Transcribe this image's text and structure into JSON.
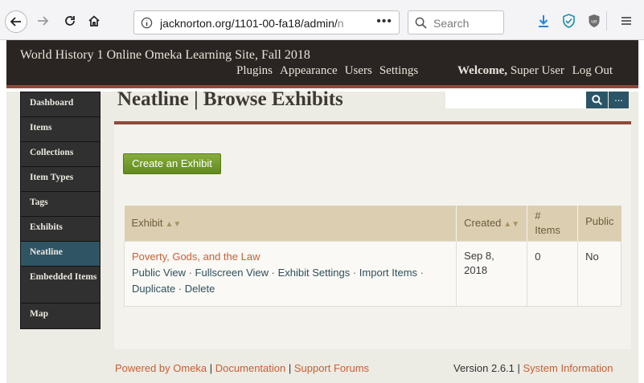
{
  "browser": {
    "url_main": "jacknorton.org/1101-00-fa18/admin/",
    "url_faded": "n",
    "url_more": "•••",
    "search_placeholder": "Search"
  },
  "site": {
    "title": "World History 1 Online Omeka Learning Site, Fall 2018",
    "nav": [
      "Plugins",
      "Appearance",
      "Users",
      "Settings"
    ],
    "welcome_label": "Welcome,",
    "user_name": "Super User",
    "logout": "Log Out"
  },
  "sidebar": {
    "items": [
      {
        "label": "Dashboard"
      },
      {
        "label": "Items"
      },
      {
        "label": "Collections"
      },
      {
        "label": "Item Types"
      },
      {
        "label": "Tags"
      },
      {
        "label": "Exhibits"
      },
      {
        "label": "Neatline",
        "active": true
      },
      {
        "label": "Embedded Items"
      },
      {
        "label": "Map"
      }
    ]
  },
  "page": {
    "title": "Neatline | Browse Exhibits",
    "search_more": "...",
    "create_button": "Create an Exhibit"
  },
  "table": {
    "headers": {
      "exhibit": "Exhibit",
      "created": "Created",
      "items_hash": "#",
      "items": "Items",
      "public": "Public"
    },
    "rows": [
      {
        "title": "Poverty, Gods, and the Law",
        "actions": [
          "Public View",
          "Fullscreen View",
          "Exhibit Settings",
          "Import Items",
          "Duplicate",
          "Delete"
        ],
        "created_line1": "Sep 8,",
        "created_line2": "2018",
        "items": "0",
        "public": "No"
      }
    ]
  },
  "footer": {
    "powered": "Powered by Omeka",
    "documentation": "Documentation",
    "forums": "Support Forums",
    "version": "Version 2.6.1",
    "system_info": "System Information"
  },
  "colors": {
    "header_bg": "#2a2522",
    "accent_rust": "#8e4a3a",
    "link_orange": "#c95f32",
    "active_nav": "#2f5464",
    "create_green": "#6f9627",
    "table_header": "#dccfb1"
  }
}
